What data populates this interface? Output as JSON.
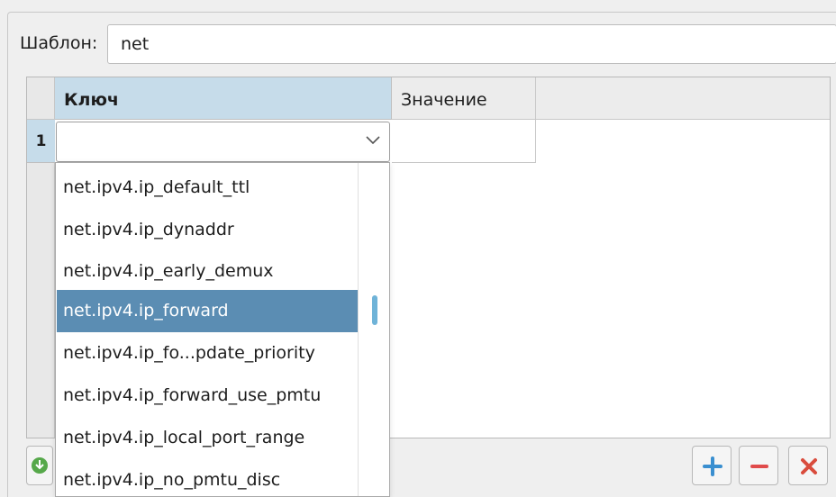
{
  "template": {
    "label": "Шаблон:",
    "value": "net"
  },
  "table": {
    "columns": {
      "key": "Ключ",
      "value": "Значение"
    },
    "rows": [
      {
        "number": "1",
        "key": "",
        "value": ""
      }
    ]
  },
  "dropdown": {
    "items": [
      "net.ipv4.ip_default_ttl",
      "net.ipv4.ip_dynaddr",
      "net.ipv4.ip_early_demux",
      "net.ipv4.ip_forward",
      "net.ipv4.ip_fo...pdate_priority",
      "net.ipv4.ip_forward_use_pmtu",
      "net.ipv4.ip_local_port_range",
      "net.ipv4.ip_no_pmtu_disc"
    ],
    "selected_index": 3,
    "scroll_position": 0.38
  },
  "colors": {
    "selected_row": "#5b8db3",
    "header_highlight": "#c6dcea",
    "add_icon": "#3a8fd0",
    "remove_icon": "#e04b4b",
    "delete_icon": "#d94c3d",
    "download_icon": "#56a84a"
  },
  "icons": {
    "dropdown": "chevron-down-icon",
    "add": "plus-icon",
    "remove": "minus-icon",
    "delete": "x-icon",
    "download": "download-icon"
  }
}
